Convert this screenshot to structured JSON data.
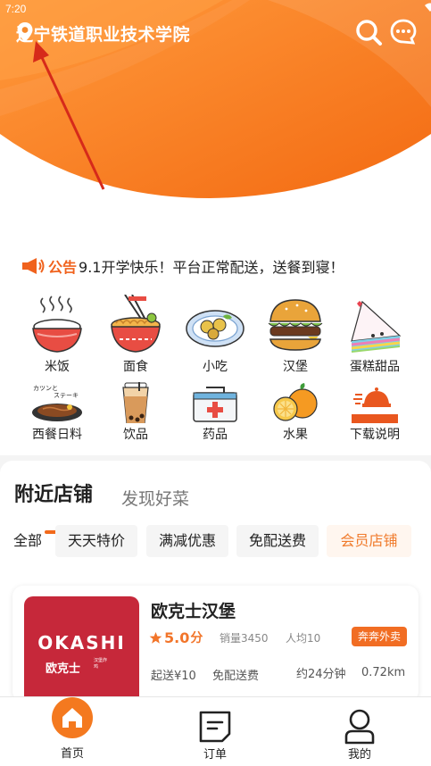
{
  "status_bar": {
    "time": "7:20"
  },
  "header": {
    "location": "辽宁铁道职业技术学院",
    "icons": {
      "location": "location-pin-icon",
      "search": "search-icon",
      "message": "message-icon"
    }
  },
  "notice": {
    "label": "公告",
    "text": "9.1开学快乐！平台正常配送，送餐到寝！"
  },
  "categories": [
    {
      "label": "米饭",
      "icon": "rice-bowl-icon"
    },
    {
      "label": "面食",
      "icon": "noodle-bowl-icon"
    },
    {
      "label": "小吃",
      "icon": "snack-plate-icon"
    },
    {
      "label": "汉堡",
      "icon": "burger-icon"
    },
    {
      "label": "蛋糕甜品",
      "icon": "cake-icon"
    },
    {
      "label": "西餐日料",
      "icon": "steak-icon"
    },
    {
      "label": "饮品",
      "icon": "drink-cup-icon"
    },
    {
      "label": "药品",
      "icon": "medicine-kit-icon"
    },
    {
      "label": "水果",
      "icon": "orange-fruit-icon"
    },
    {
      "label": "下载说明",
      "icon": "delivery-download-icon"
    }
  ],
  "stores_section": {
    "tab_active": "附近店铺",
    "tab_inactive": "发现好菜",
    "filters": [
      "全部",
      "天天特价",
      "满减优惠",
      "免配送费",
      "会员店铺"
    ]
  },
  "store": {
    "logo_text": "OKASHI",
    "logo_cn": "欧克士",
    "logo_tag": "汉堡炸鸡",
    "name": "欧克士汉堡",
    "rating": "5.0",
    "rating_unit": "分",
    "sales": "销量3450",
    "avg_price": "人均10",
    "badge": "奔奔外卖",
    "min_order": "起送¥10",
    "free_delivery": "免配送费",
    "eta": "约24分钟",
    "distance": "0.72km"
  },
  "bottom_nav": {
    "home": "首页",
    "orders": "订单",
    "me": "我的"
  },
  "colors": {
    "accent": "#f26a1b",
    "brand_red": "#c6283a"
  }
}
